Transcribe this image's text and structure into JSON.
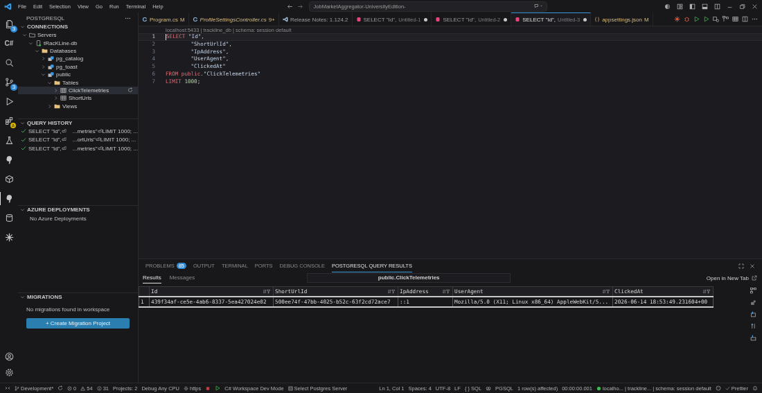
{
  "menu": [
    "File",
    "Edit",
    "Selection",
    "View",
    "Go",
    "Run",
    "Terminal",
    "Help"
  ],
  "command_center": "JobMarketAggregator-UniversityEdition-",
  "activity": [
    {
      "kind": "files",
      "badge": "3",
      "selected": false
    },
    {
      "kind": "text",
      "text": "C#",
      "selected": false
    },
    {
      "kind": "search",
      "selected": false
    },
    {
      "kind": "scm",
      "badge": "3",
      "selected": false
    },
    {
      "kind": "debug",
      "selected": false
    },
    {
      "kind": "extensions",
      "warning": true,
      "selected": false
    },
    {
      "kind": "flask",
      "selected": false
    },
    {
      "kind": "elephant",
      "selected": false
    },
    {
      "kind": "box",
      "selected": false
    },
    {
      "kind": "elephant",
      "selected": true
    },
    {
      "kind": "database",
      "selected": false
    },
    {
      "kind": "spark",
      "selected": false
    }
  ],
  "sidebar": {
    "title": "POSTGRESQL",
    "connections": {
      "title": "CONNECTIONS",
      "expanded": true,
      "tree": [
        {
          "label": "Servers",
          "kind": "folder-outline",
          "expanded": true,
          "selected": false,
          "children": [
            {
              "label": "tRacKLine-db",
              "kind": "server",
              "expanded": true,
              "selected": false,
              "children": [
                {
                  "label": "Databases",
                  "kind": "folder",
                  "expanded": true,
                  "selected": false,
                  "children": [
                    {
                      "label": "pg_catalog",
                      "kind": "schema",
                      "expanded": false,
                      "selected": false
                    },
                    {
                      "label": "pg_toast",
                      "kind": "schema",
                      "expanded": false,
                      "selected": false
                    },
                    {
                      "label": "public",
                      "kind": "schema",
                      "expanded": true,
                      "selected": false,
                      "children": [
                        {
                          "label": "Tables",
                          "kind": "folder",
                          "expanded": true,
                          "selected": false,
                          "children": [
                            {
                              "label": "ClickTelemetries",
                              "kind": "table",
                              "expanded": false,
                              "selected": true
                            },
                            {
                              "label": "ShortUrls",
                              "kind": "table",
                              "expanded": false,
                              "selected": false
                            }
                          ]
                        },
                        {
                          "label": "Views",
                          "kind": "folder",
                          "expanded": false,
                          "selected": false
                        }
                      ]
                    }
                  ]
                }
              ]
            }
          ]
        }
      ]
    },
    "query_history": {
      "title": "QUERY HISTORY",
      "expanded": true,
      "items": [
        {
          "query": "SELECT \"Id\",⏎",
          "tail": "...metries\"⏎LIMIT 1000; ...",
          "succeeded": true
        },
        {
          "query": "SELECT \"Id\",⏎",
          "tail": "...ortUrls\"⏎LIMIT 1000; ...",
          "succeeded": true
        },
        {
          "query": "SELECT \"Id\",⏎",
          "tail": "...metries\"⏎LIMIT 1000; ...",
          "succeeded": true
        }
      ]
    },
    "azure": {
      "title": "AZURE DEPLOYMENTS",
      "expanded": true,
      "message": "No Azure Deployments"
    },
    "migrations": {
      "title": "MIGRATIONS",
      "expanded": true,
      "message": "No migrations found in workspace",
      "button": "+ Create Migration Project"
    }
  },
  "tabs": [
    {
      "kind": "csharp",
      "label": "Program.cs",
      "status": "M",
      "preview": false,
      "dirty": false,
      "selected": false
    },
    {
      "kind": "csharp",
      "label": "ProfileSettingsController.cs",
      "status": "9+",
      "preview": true,
      "dirty": false,
      "selected": false
    },
    {
      "kind": "vscode",
      "label": "Release Notes: 1.124.2",
      "preview": false,
      "dirty": false,
      "selected": false
    },
    {
      "kind": "sql",
      "label": "SELECT \"Id\",",
      "detail": "Untitled-1",
      "preview": false,
      "dirty": true,
      "selected": false
    },
    {
      "kind": "sql",
      "label": "SELECT \"Id\",",
      "detail": "Untitled-2",
      "preview": false,
      "dirty": true,
      "selected": false
    },
    {
      "kind": "sql",
      "label": "SELECT \"Id\",",
      "detail": "Untitled-3",
      "preview": false,
      "dirty": true,
      "selected": true
    },
    {
      "kind": "json",
      "label": "appsettings.json",
      "status": "M",
      "preview": false,
      "dirty": false,
      "selected": false
    }
  ],
  "editor": {
    "connection_info": "localhost:5433 | trackline_db | schema: session default",
    "lines": [
      {
        "number": "1",
        "indented": false,
        "tokens": [
          {
            "kind": "keyword",
            "text": "SELECT"
          },
          {
            "kind": "identifier",
            "text": "\"Id\"",
            "gap": true
          },
          {
            "kind": "punctuation",
            "text": ","
          }
        ]
      },
      {
        "number": "2",
        "indented": true,
        "tokens": [
          {
            "kind": "identifier",
            "text": "\"ShortUrlId\""
          },
          {
            "kind": "punctuation",
            "text": ","
          }
        ]
      },
      {
        "number": "3",
        "indented": true,
        "tokens": [
          {
            "kind": "identifier",
            "text": "\"IpAddress\""
          },
          {
            "kind": "punctuation",
            "text": ","
          }
        ]
      },
      {
        "number": "4",
        "indented": true,
        "tokens": [
          {
            "kind": "identifier",
            "text": "\"UserAgent\""
          },
          {
            "kind": "punctuation",
            "text": ","
          }
        ]
      },
      {
        "number": "5",
        "indented": true,
        "tokens": [
          {
            "kind": "identifier",
            "text": "\"ClickedAt\""
          }
        ]
      },
      {
        "number": "6",
        "indented": false,
        "tokens": [
          {
            "kind": "keyword",
            "text": "FROM"
          },
          {
            "kind": "keyword",
            "text": "public",
            "gap": true
          },
          {
            "kind": "punctuation",
            "text": "."
          },
          {
            "kind": "identifier",
            "text": "\"ClickTelemetries\""
          }
        ]
      },
      {
        "number": "7",
        "indented": false,
        "tokens": [
          {
            "kind": "keyword",
            "text": "LIMIT"
          },
          {
            "kind": "number",
            "text": "1000",
            "gap": true
          },
          {
            "kind": "punctuation",
            "text": ";"
          }
        ]
      }
    ]
  },
  "panel": {
    "tabs": [
      {
        "label": "PROBLEMS",
        "badge": "85",
        "selected": false
      },
      {
        "label": "OUTPUT",
        "selected": false
      },
      {
        "label": "TERMINAL",
        "selected": false
      },
      {
        "label": "PORTS",
        "selected": false
      },
      {
        "label": "DEBUG CONSOLE",
        "selected": false
      },
      {
        "label": "POSTGRESQL QUERY RESULTS",
        "selected": true
      }
    ],
    "result_tabs": [
      {
        "label": "Results",
        "selected": true
      },
      {
        "label": "Messages",
        "selected": false
      }
    ],
    "table_name": "public.ClickTelemetries",
    "open_link": "Open in New Tab",
    "table": {
      "columns": [
        "Id",
        "ShortUrlId",
        "IpAddress",
        "UserAgent",
        "ClickedAt"
      ],
      "rows": [
        {
          "number": "1",
          "cells": [
            "439f34af-ce5e-4ab6-8337-5ea427024e02",
            "500ee74f-47bb-4025-b52c-63f2cd72ace7",
            "::1",
            "Mozilla/5.0 (X11; Linux x86_64) AppleWebKit/5...",
            "2026-06-14 18:53:49.231604+00"
          ]
        }
      ]
    }
  },
  "status_bar": {
    "left": [
      {
        "kind": "remote"
      },
      {
        "kind": "branch",
        "text": "Development*"
      },
      {
        "kind": "sync"
      },
      {
        "kind": "error",
        "text": "0"
      },
      {
        "kind": "warning",
        "text": "54"
      },
      {
        "kind": "info",
        "text": "31"
      },
      {
        "kind": "text",
        "text": "Projects: 2"
      },
      {
        "kind": "text",
        "text": "Debug Any CPU"
      },
      {
        "kind": "gear",
        "text": "https"
      },
      {
        "kind": "bug"
      },
      {
        "kind": "play"
      },
      {
        "kind": "text",
        "text": "C# Workspace Dev Mode"
      },
      {
        "kind": "db",
        "text": "Select Postgres Server"
      }
    ],
    "right": [
      {
        "kind": "text",
        "text": "Ln 1, Col 1"
      },
      {
        "kind": "text",
        "text": "Spaces: 4"
      },
      {
        "kind": "text",
        "text": "UTF-8"
      },
      {
        "kind": "text",
        "text": "LF"
      },
      {
        "kind": "text",
        "text": "{ } SQL"
      },
      {
        "kind": "copilot"
      },
      {
        "kind": "text",
        "text": "PGSQL"
      },
      {
        "kind": "text",
        "text": "1 row(s) affected)"
      },
      {
        "kind": "text",
        "text": "00:00:00.001"
      },
      {
        "kind": "dot",
        "text": "localho... | trackline... | schema: session default"
      },
      {
        "kind": "smile"
      },
      {
        "kind": "check",
        "text": "Prettier"
      },
      {
        "kind": "bell"
      }
    ]
  }
}
